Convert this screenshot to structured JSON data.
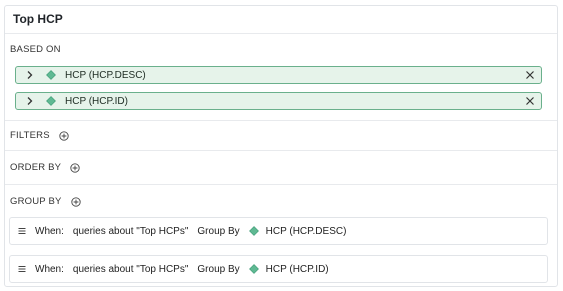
{
  "title": "Top HCP",
  "colors": {
    "accent": "#5fb993",
    "chip_bg": "#e6f3ea",
    "chip_border": "#6ab08c"
  },
  "based_on": {
    "label": "BASED ON",
    "items": [
      {
        "label": "HCP (HCP.DESC)",
        "icon": "diamond-icon"
      },
      {
        "label": "HCP (HCP.ID)",
        "icon": "diamond-icon"
      }
    ]
  },
  "filters": {
    "label": "FILTERS"
  },
  "order_by": {
    "label": "ORDER BY"
  },
  "group_by": {
    "label": "GROUP BY",
    "rules": [
      {
        "when": "When:",
        "query": "queries about \"Top HCPs\"",
        "group_by": "Group By",
        "field": "HCP (HCP.DESC)"
      },
      {
        "when": "When:",
        "query": "queries about \"Top HCPs\"",
        "group_by": "Group By",
        "field": "HCP (HCP.ID)"
      }
    ]
  }
}
